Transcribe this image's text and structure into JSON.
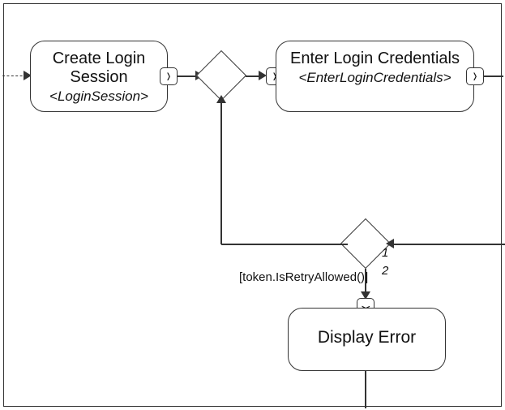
{
  "activities": {
    "createLogin": {
      "title": "Create Login Session",
      "stereo": "<LoginSession>"
    },
    "enterCreds": {
      "title": "Enter Login Credentials",
      "stereo": "<EnterLoginCredentials>"
    },
    "displayError": {
      "title": "Display Error"
    }
  },
  "edges": {
    "guard1": "[token.IsRetryAllowed()]",
    "branch1": "1",
    "branch2": "2"
  },
  "pinGlyphs": {
    "right": "❭",
    "down": "❯"
  }
}
